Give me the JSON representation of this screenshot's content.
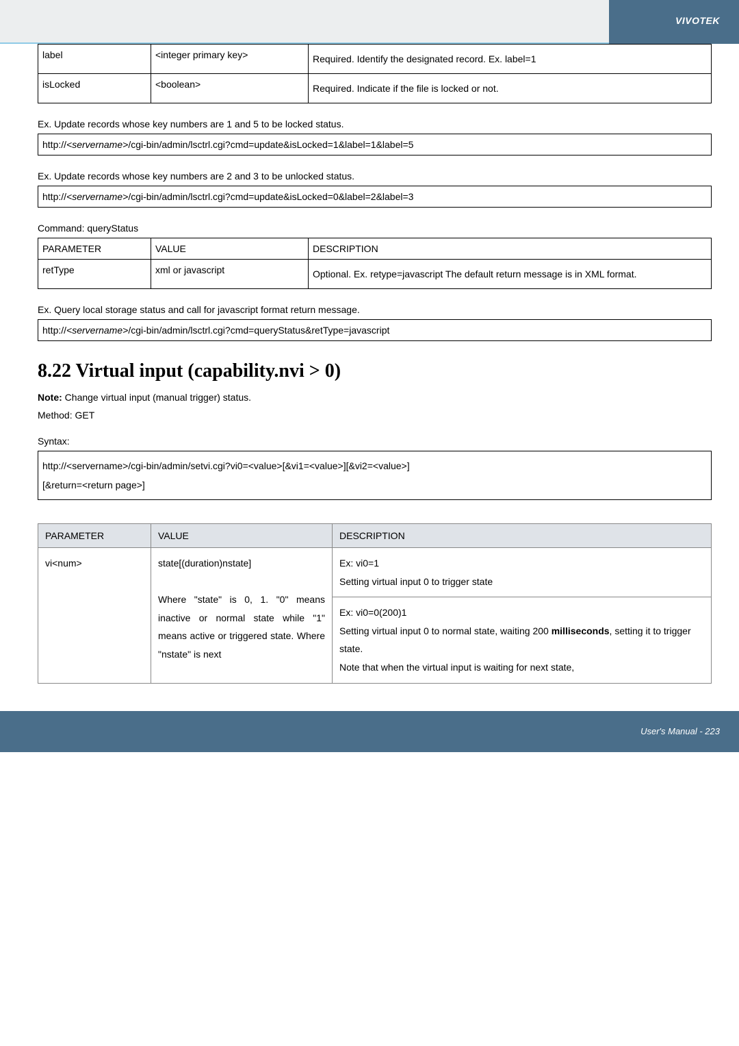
{
  "brand": "VIVOTEK",
  "footer": "User's Manual - 223",
  "table1": {
    "rows": [
      {
        "p": "label",
        "v": "<integer primary key>",
        "d": "Required.\nIdentify the designated record.\nEx. label=1"
      },
      {
        "p": "isLocked",
        "v": "<boolean>",
        "d": "Required.\nIndicate if the file is locked or not."
      }
    ]
  },
  "ex1": {
    "text": "Ex. Update records whose key numbers are 1 and 5 to be locked status.",
    "url_pre": "http://",
    "url_srv": "<servername>",
    "url_post": "/cgi-bin/admin/lsctrl.cgi?cmd=update&isLocked=1&label=1&label=5"
  },
  "ex2": {
    "text": "Ex. Update records whose key numbers are 2 and 3 to be unlocked status.",
    "url_pre": "http://",
    "url_srv": "<servername>",
    "url_post": "/cgi-bin/admin/lsctrl.cgi?cmd=update&isLocked=0&label=2&label=3"
  },
  "cmd2": "Command: queryStatus",
  "table2": {
    "head": {
      "p": "PARAMETER",
      "v": "VALUE",
      "d": "DESCRIPTION"
    },
    "rows": [
      {
        "p": "retType",
        "v": "xml or javascript",
        "d": "Optional.\nEx. retype=javascript\nThe default return message is in XML format."
      }
    ]
  },
  "ex3": {
    "text": "Ex. Query local storage status and call for javascript format return message.",
    "url_pre": "http://",
    "url_srv": "<servername>",
    "url_post": "/cgi-bin/admin/lsctrl.cgi?cmd=queryStatus&retType=javascript"
  },
  "section": "8.22 Virtual input (capability.nvi > 0)",
  "note_label": "Note:",
  "note_text": " Change virtual input (manual trigger) status.",
  "method": "Method: GET",
  "syntax_label": "Syntax:",
  "syntax_box": {
    "line1": "http://<servername>/cgi-bin/admin/setvi.cgi?vi0=<value>[&vi1=<value>][&vi2=<value>]",
    "line2": "[&return=<return page>]"
  },
  "table3": {
    "head": {
      "p": "PARAMETER",
      "v": "VALUE",
      "d": "DESCRIPTION"
    },
    "row": {
      "p": "vi<num>",
      "v": "state[(duration)nstate]\n\nWhere \"state\" is 0, 1. \"0\" means inactive or normal state while \"1\" means active or triggered state. Where \"nstate\" is next",
      "d1": "Ex: vi0=1\nSetting virtual input 0 to trigger state",
      "d2": "Ex: vi0=0(200)1\nSetting virtual input 0 to normal state, waiting 200 ",
      "d2b": "milliseconds",
      "d2c": ", setting it to trigger state.\nNote that when the virtual input is waiting for next state,"
    }
  }
}
